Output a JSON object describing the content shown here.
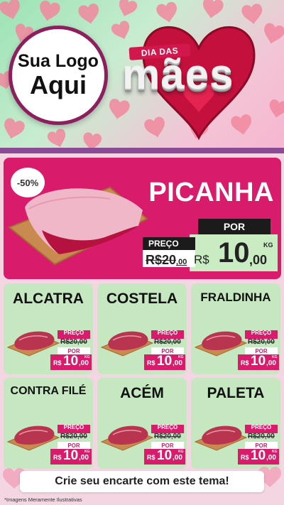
{
  "header": {
    "logo_line1": "Sua Logo",
    "logo_line2": "Aqui",
    "event_small": "DIA DAS",
    "event_big": "mães"
  },
  "featured": {
    "discount": "-50%",
    "name": "PICANHA",
    "label_preco": "PREÇO",
    "label_por": "POR",
    "old_price_int": "R$20",
    "old_price_dec": ",00",
    "currency": "R$",
    "price_int": "10",
    "price_dec": ",00",
    "unit": "KG"
  },
  "products": [
    {
      "name": "ALCATRA",
      "preco": "PREÇO",
      "old": "R$20,00",
      "por": "POR",
      "cur": "R$",
      "int": "10",
      "dec": ",00",
      "unit": "KG"
    },
    {
      "name": "COSTELA",
      "preco": "PREÇO",
      "old": "R$20,00",
      "por": "POR",
      "cur": "R$",
      "int": "10",
      "dec": ",00",
      "unit": "KG"
    },
    {
      "name": "FRALDINHA",
      "preco": "PREÇO",
      "old": "R$20,00",
      "por": "POR",
      "cur": "R$",
      "int": "10",
      "dec": ",00",
      "unit": "KG"
    },
    {
      "name": "CONTRA FILÉ",
      "preco": "PREÇO",
      "old": "R$20,00",
      "por": "POR",
      "cur": "R$",
      "int": "10",
      "dec": ",00",
      "unit": "KG"
    },
    {
      "name": "ACÉM",
      "preco": "PREÇO",
      "old": "R$20,00",
      "por": "POR",
      "cur": "R$",
      "int": "10",
      "dec": ",00",
      "unit": "KG"
    },
    {
      "name": "PALETA",
      "preco": "PREÇO",
      "old": "R$20,00",
      "por": "POR",
      "cur": "R$",
      "int": "10",
      "dec": ",00",
      "unit": "KG"
    }
  ],
  "footer": {
    "cta": "Crie seu encarte com este tema!",
    "disclaimer": "*Imagens Meramente Ilustrativas"
  },
  "colors": {
    "magenta": "#d81b6b",
    "card_green": "#c5e8c1",
    "logo_border": "#8e1f5e"
  }
}
